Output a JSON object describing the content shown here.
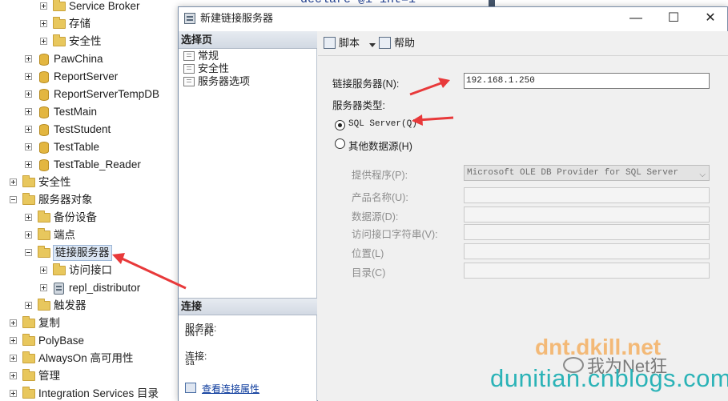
{
  "editor": {
    "code": "declare @i int=1"
  },
  "tree": {
    "nodes": [
      {
        "label": "Service Broker",
        "icon": "folder-icon"
      },
      {
        "label": "存储",
        "icon": "folder-icon"
      },
      {
        "label": "安全性",
        "icon": "folder-icon"
      },
      {
        "label": "PawChina",
        "icon": "database-icon"
      },
      {
        "label": "ReportServer",
        "icon": "database-icon"
      },
      {
        "label": "ReportServerTempDB",
        "icon": "database-icon"
      },
      {
        "label": "TestMain",
        "icon": "database-icon"
      },
      {
        "label": "TestStudent",
        "icon": "database-icon"
      },
      {
        "label": "TestTable",
        "icon": "database-icon"
      },
      {
        "label": "TestTable_Reader",
        "icon": "database-icon"
      },
      {
        "label": "安全性",
        "icon": "folder-icon"
      },
      {
        "label": "服务器对象",
        "icon": "folder-icon"
      },
      {
        "label": "备份设备",
        "icon": "folder-icon"
      },
      {
        "label": "端点",
        "icon": "folder-icon"
      },
      {
        "label": "链接服务器",
        "icon": "folder-icon"
      },
      {
        "label": "访问接口",
        "icon": "folder-icon"
      },
      {
        "label": "repl_distributor",
        "icon": "linked-server-icon"
      },
      {
        "label": "触发器",
        "icon": "folder-icon"
      },
      {
        "label": "复制",
        "icon": "folder-icon"
      },
      {
        "label": "PolyBase",
        "icon": "folder-icon"
      },
      {
        "label": "AlwaysOn 高可用性",
        "icon": "folder-icon"
      },
      {
        "label": "管理",
        "icon": "folder-icon"
      },
      {
        "label": "Integration Services 目录",
        "icon": "folder-icon"
      }
    ]
  },
  "dialog": {
    "title": "新建链接服务器",
    "window_buttons": {
      "minimize": "—",
      "maximize": "☐",
      "close": "✕"
    },
    "select_page": {
      "header": "选择页",
      "pages": [
        "常规",
        "安全性",
        "服务器选项"
      ]
    },
    "connection": {
      "header": "连接",
      "server_label": "服务器:",
      "server_value": "DNT-PC",
      "connection_label": "连接:",
      "connection_value": "sa",
      "view_properties": "查看连接属性"
    },
    "toolbar": {
      "script": "脚本",
      "help": "帮助"
    },
    "form": {
      "linked_server_label": "链接服务器(N):",
      "linked_server_value": "192.168.1.250",
      "server_type_label": "服务器类型:",
      "sql_server_option": "SQL Server(Q)",
      "other_source_option": "其他数据源(H)",
      "provider_label": "提供程序(P):",
      "provider_value": "Microsoft OLE DB Provider for SQL Server",
      "product_name_label": "产品名称(U):",
      "data_source_label": "数据源(D):",
      "provider_string_label": "访问接口字符串(V):",
      "location_label": "位置(L)",
      "catalog_label": "目录(C)",
      "selected_option": "SQL Server(Q)"
    }
  },
  "watermark": {
    "top": "dnt.dkill.net",
    "middle": "我为Net狂",
    "bottom": "dunitian.cnblogs.com"
  },
  "colors": {
    "arrow": "#e8393a",
    "link": "#0b3a9c",
    "watermark_teal": "#2bb3b7",
    "watermark_orange": "#f4b46a"
  }
}
